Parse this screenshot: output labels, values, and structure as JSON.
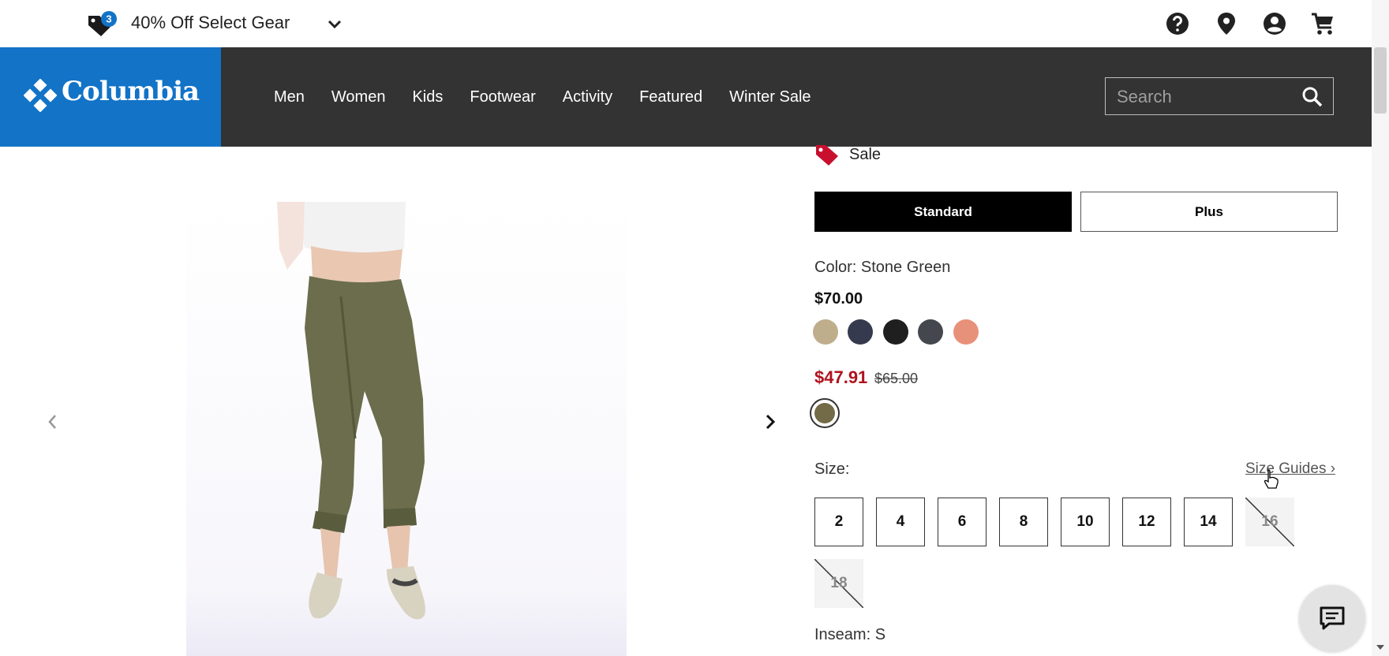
{
  "promo": {
    "text": "40% Off Select Gear",
    "badge_count": "3"
  },
  "header_icons": [
    "help-icon",
    "location-icon",
    "account-icon",
    "cart-icon"
  ],
  "brand": {
    "name": "Columbia",
    "color": "#1273c7"
  },
  "nav": {
    "links": [
      "Men",
      "Women",
      "Kids",
      "Footwear",
      "Activity",
      "Featured",
      "Winter Sale"
    ],
    "search_placeholder": "Search"
  },
  "product": {
    "sale_label": "Sale",
    "fit_options": [
      "Standard",
      "Plus"
    ],
    "selected_fit": "Standard",
    "color_label": "Color: Stone Green",
    "regular_price": "$70.00",
    "regular_swatches": [
      "#bfae8c",
      "#363a4e",
      "#1f1f1f",
      "#45474f",
      "#e8917a"
    ],
    "sale_price": "$47.91",
    "original_price": "$65.00",
    "sale_swatch": "#736a47",
    "size_label": "Size:",
    "size_guides_label": "Size Guides ›",
    "sizes": [
      {
        "label": "2",
        "available": true
      },
      {
        "label": "4",
        "available": true
      },
      {
        "label": "6",
        "available": true
      },
      {
        "label": "8",
        "available": true
      },
      {
        "label": "10",
        "available": true
      },
      {
        "label": "12",
        "available": true
      },
      {
        "label": "14",
        "available": true
      },
      {
        "label": "16",
        "available": false
      },
      {
        "label": "18",
        "available": false
      }
    ],
    "inseam_label": "Inseam: S"
  },
  "colors": {
    "sale_red": "#b0121d",
    "nav_bg": "#333333"
  }
}
